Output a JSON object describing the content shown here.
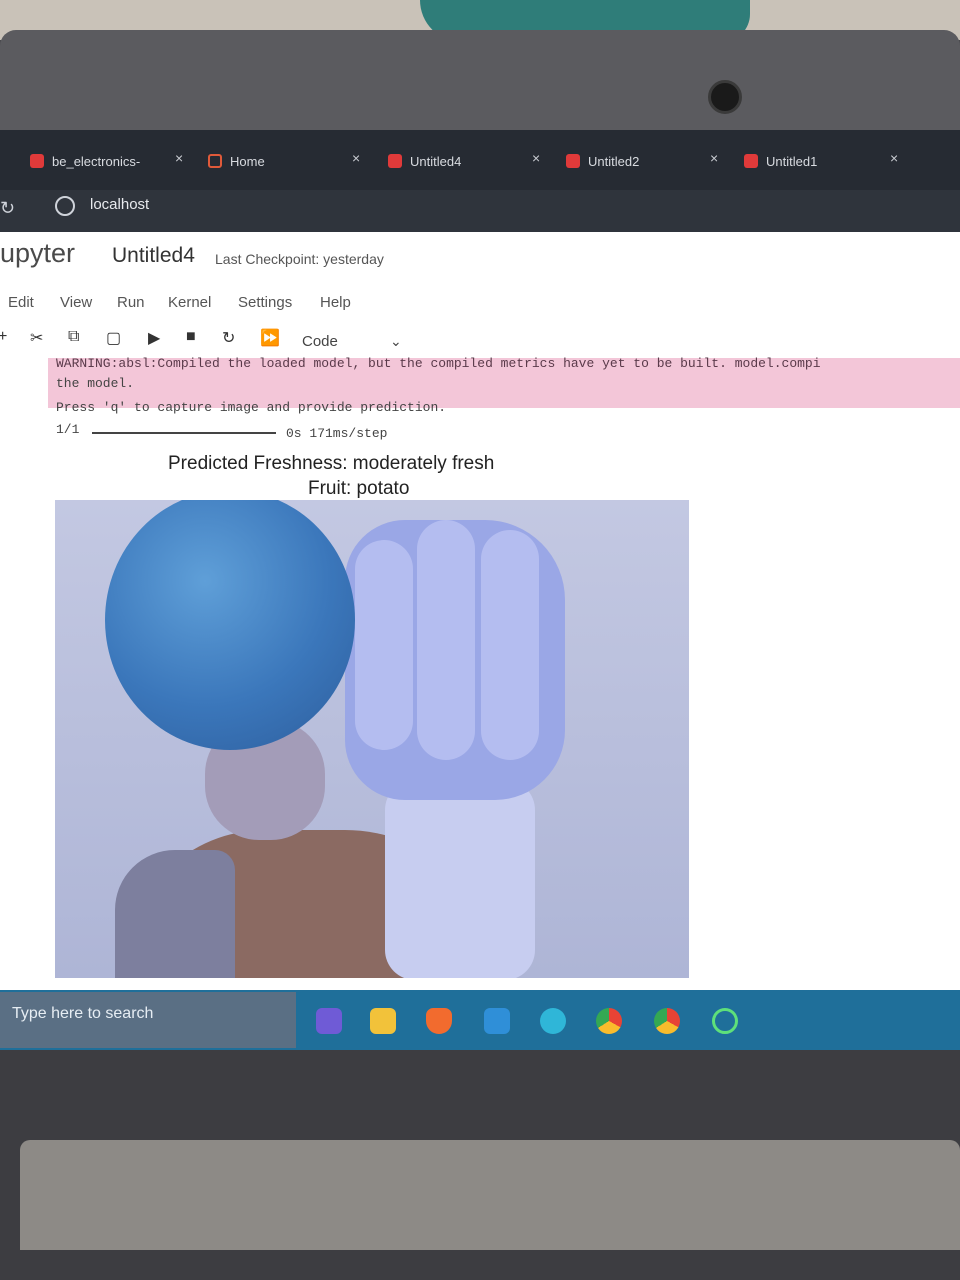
{
  "browser": {
    "tabs": [
      {
        "label": "be_electronics-"
      },
      {
        "label": "Home"
      },
      {
        "label": "Untitled4"
      },
      {
        "label": "Untitled2"
      },
      {
        "label": "Untitled1"
      }
    ],
    "url": "localhost",
    "reload_icon": "reload-icon"
  },
  "jupyter": {
    "logo": "jupyter",
    "notebook_title": "Untitled4",
    "checkpoint": "Last Checkpoint: yesterday",
    "menu": [
      "Edit",
      "View",
      "Run",
      "Kernel",
      "Settings",
      "Help"
    ],
    "toolbar": {
      "icons": [
        "add-icon",
        "cut-icon",
        "copy-icon",
        "paste-icon",
        "run-icon",
        "stop-icon",
        "restart-icon",
        "restart-run-all-icon"
      ],
      "cell_type": "Code"
    }
  },
  "output": {
    "warning_line1": "WARNING:absl:Compiled the loaded model, but the compiled metrics have yet to be built.  model.compi",
    "warning_line2": "the model.",
    "prompt": "Press 'q' to capture image and provide prediction.",
    "progress_count": "1/1",
    "progress_time": "0s 171ms/step",
    "prediction_title": "Predicted Freshness: moderately fresh",
    "prediction_fruit": "Fruit: potato"
  },
  "taskbar": {
    "search_placeholder": "Type here to search",
    "apps": [
      "copilot-icon",
      "file-explorer-icon",
      "brave-icon",
      "outlook-icon",
      "edge-icon",
      "chrome-icon",
      "chrome-profile-icon",
      "cortana-icon"
    ]
  }
}
